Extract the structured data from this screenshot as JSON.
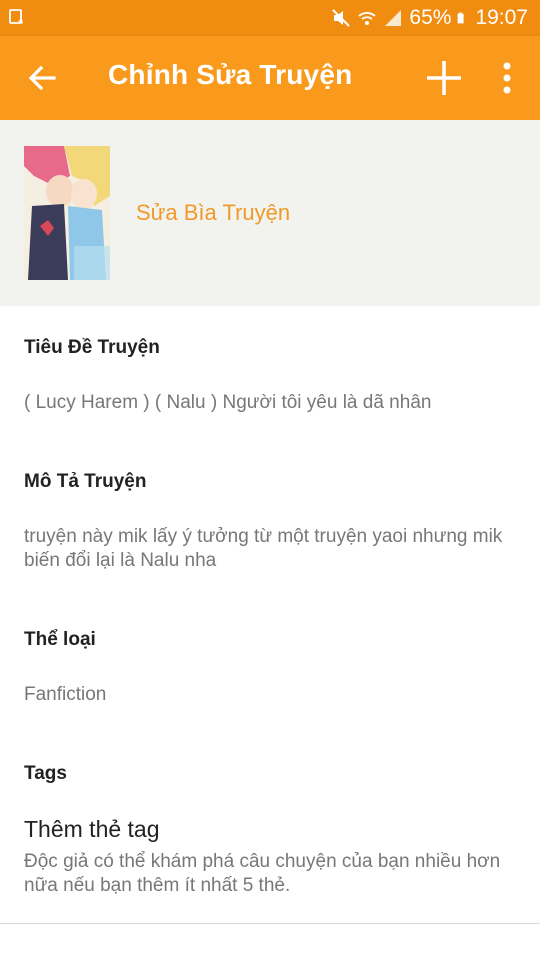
{
  "status_bar": {
    "battery_percent": "65%",
    "time": "19:07",
    "icons": [
      "notification-icon",
      "mute-icon",
      "wifi-icon",
      "signal-icon",
      "battery-icon"
    ]
  },
  "appbar": {
    "title": "Chỉnh Sửa Truyện",
    "back_icon": "arrow-left-icon",
    "add_icon": "plus-icon",
    "more_icon": "more-vert-icon"
  },
  "cover": {
    "edit_label": "Sửa Bìa Truyện"
  },
  "story": {
    "title_label": "Tiêu Đề Truyện",
    "title_value": "( Lucy Harem ) ( Nalu ) Người tôi yêu là dã nhân",
    "description_label": "Mô Tả Truyện",
    "description_value": "truyện này mik lấy ý tưởng từ một truyện yaoi nhưng mik biến đổi lại là Nalu nha",
    "genre_label": "Thể loại",
    "genre_value": "Fanfiction",
    "tags_label": "Tags",
    "add_tag_title": "Thêm thẻ tag",
    "add_tag_desc": "Độc giả có thể khám phá câu chuyện của bạn nhiều hơn nữa nếu bạn thêm ít nhất 5 thẻ."
  },
  "colors": {
    "appbar": "#fa9a1c",
    "statusbar": "#f08c10",
    "accent": "#f09a2a"
  }
}
